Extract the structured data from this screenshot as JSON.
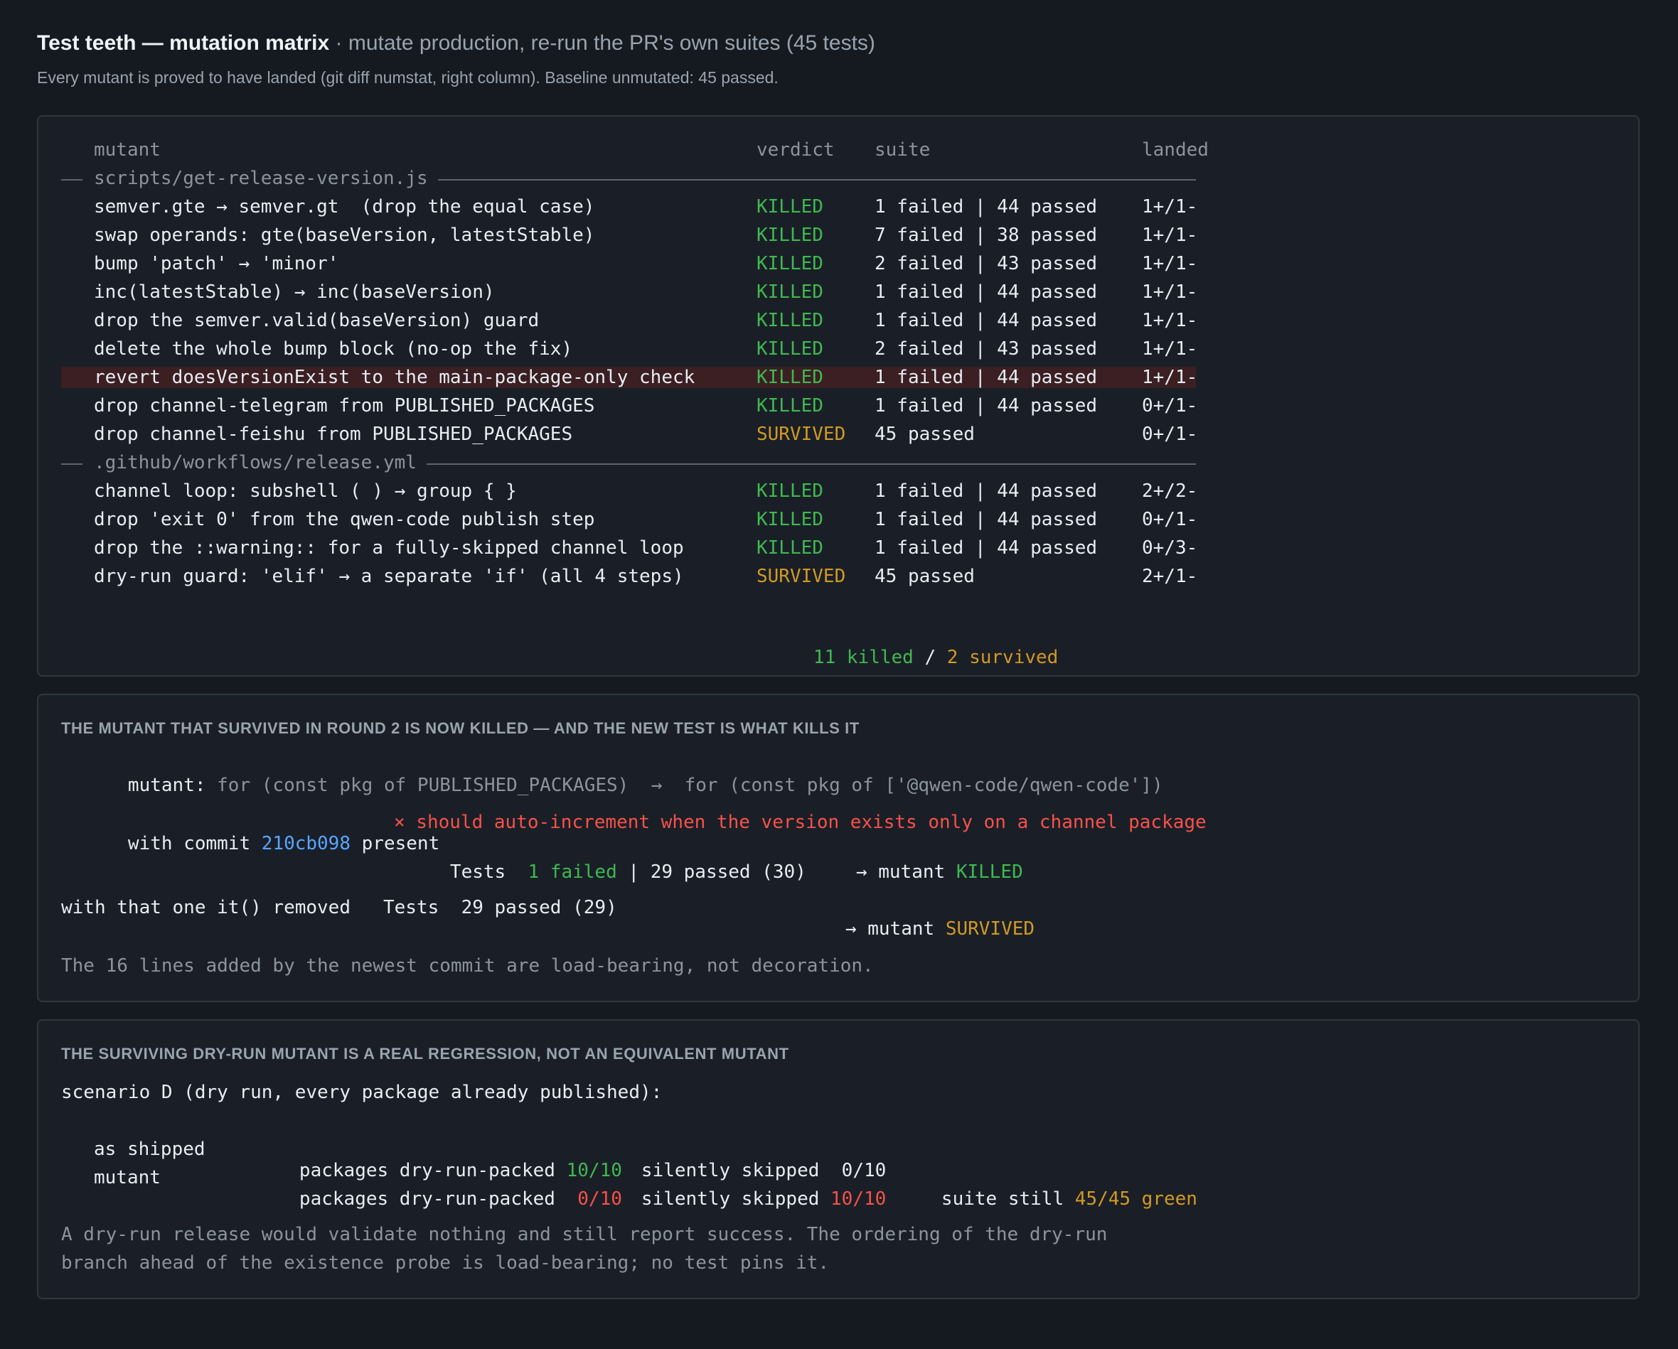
{
  "header": {
    "title": "Test teeth — mutation matrix",
    "subtitle": "· mutate production, re-run the PR's own suites (45 tests)",
    "description": "Every mutant is proved to have landed (git diff numstat, right column). Baseline unmutated: 45 passed."
  },
  "matrix": {
    "columns": {
      "mutant": "mutant",
      "verdict": "verdict",
      "suite": "suite",
      "landed": "landed"
    },
    "sections": [
      {
        "file": "scripts/get-release-version.js",
        "rows": [
          {
            "mutant": "semver.gte → semver.gt  (drop the equal case)",
            "verdict": "KILLED",
            "suite": "1 failed | 44 passed",
            "landed": "1+/1-"
          },
          {
            "mutant": "swap operands: gte(baseVersion, latestStable)",
            "verdict": "KILLED",
            "suite": "7 failed | 38 passed",
            "landed": "1+/1-"
          },
          {
            "mutant": "bump 'patch' → 'minor'",
            "verdict": "KILLED",
            "suite": "2 failed | 43 passed",
            "landed": "1+/1-"
          },
          {
            "mutant": "inc(latestStable) → inc(baseVersion)",
            "verdict": "KILLED",
            "suite": "1 failed | 44 passed",
            "landed": "1+/1-"
          },
          {
            "mutant": "drop the semver.valid(baseVersion) guard",
            "verdict": "KILLED",
            "suite": "1 failed | 44 passed",
            "landed": "1+/1-"
          },
          {
            "mutant": "delete the whole bump block (no-op the fix)",
            "verdict": "KILLED",
            "suite": "2 failed | 43 passed",
            "landed": "1+/1-"
          },
          {
            "mutant": "revert doesVersionExist to the main-package-only check",
            "verdict": "KILLED",
            "suite": "1 failed | 44 passed",
            "landed": "1+/1-",
            "highlight": true
          },
          {
            "mutant": "drop channel-telegram from PUBLISHED_PACKAGES",
            "verdict": "KILLED",
            "suite": "1 failed | 44 passed",
            "landed": "0+/1-"
          },
          {
            "mutant": "drop channel-feishu from PUBLISHED_PACKAGES",
            "verdict": "SURVIVED",
            "suite": "45 passed",
            "landed": "0+/1-"
          }
        ]
      },
      {
        "file": ".github/workflows/release.yml",
        "rows": [
          {
            "mutant": "channel loop: subshell ( ) → group { }",
            "verdict": "KILLED",
            "suite": "1 failed | 44 passed",
            "landed": "2+/2-"
          },
          {
            "mutant": "drop 'exit 0' from the qwen-code publish step",
            "verdict": "KILLED",
            "suite": "1 failed | 44 passed",
            "landed": "0+/1-"
          },
          {
            "mutant": "drop the ::warning:: for a fully-skipped channel loop",
            "verdict": "KILLED",
            "suite": "1 failed | 44 passed",
            "landed": "0+/3-"
          },
          {
            "mutant": "dry-run guard: 'elif' → a separate 'if' (all 4 steps)",
            "verdict": "SURVIVED",
            "suite": "45 passed",
            "landed": "2+/1-"
          }
        ]
      }
    ],
    "totals": {
      "killed": "11 killed",
      "sep": " / ",
      "survived": "2 survived"
    }
  },
  "round2": {
    "caption": "THE MUTANT THAT SURVIVED IN ROUND 2 IS NOW KILLED — AND THE NEW TEST IS WHAT KILLS IT",
    "mutant_label": "mutant:",
    "mutant_code": " for (const pkg of PUBLISHED_PACKAGES)  →  for (const pkg of ['@qwen-code/qwen-code'])",
    "commit_prefix": "with commit ",
    "commit_hash": "210cb098",
    "commit_suffix": " present",
    "fail_msg": "× should auto-increment when the version exists only on a channel package",
    "tests1_label": "Tests  ",
    "tests1_failed": "1 failed",
    "tests1_rest": " | 29 passed (30)",
    "arrow1": "→ mutant ",
    "verdict1": "KILLED",
    "removed_label": "with that one it() removed",
    "tests2": "Tests  29 passed (29)",
    "arrow2": "→ mutant ",
    "verdict2": "SURVIVED",
    "note": "The 16 lines added by the newest commit are load-bearing, not decoration."
  },
  "dryrun": {
    "caption": "THE SURVIVING DRY-RUN MUTANT IS A REAL REGRESSION, NOT AN EQUIVALENT MUTANT",
    "scenario": "scenario D (dry run, every package already published):",
    "rows": [
      {
        "label": "as shipped",
        "packed_label": "packages dry-run-packed ",
        "packed": "10/10",
        "skipped_label": "silently skipped ",
        "skipped": " 0/10"
      },
      {
        "label": "mutant",
        "packed_label": "packages dry-run-packed ",
        "packed": " 0/10",
        "skipped_label": "silently skipped ",
        "skipped": "10/10",
        "suite_label": "suite still ",
        "suite": "45/45 green"
      }
    ],
    "note1": "A dry-run release would validate nothing and still report success. The ordering of the dry-run",
    "note2": "branch ahead of the existence probe is load-bearing; no test pins it."
  },
  "colors": {
    "background": "#151a21",
    "panel": "#1a1f27",
    "killed": "#3fb950",
    "survived": "#d29922",
    "failure": "#f85149",
    "hash": "#58a6ff",
    "highlight_row": "#3b1f22"
  }
}
